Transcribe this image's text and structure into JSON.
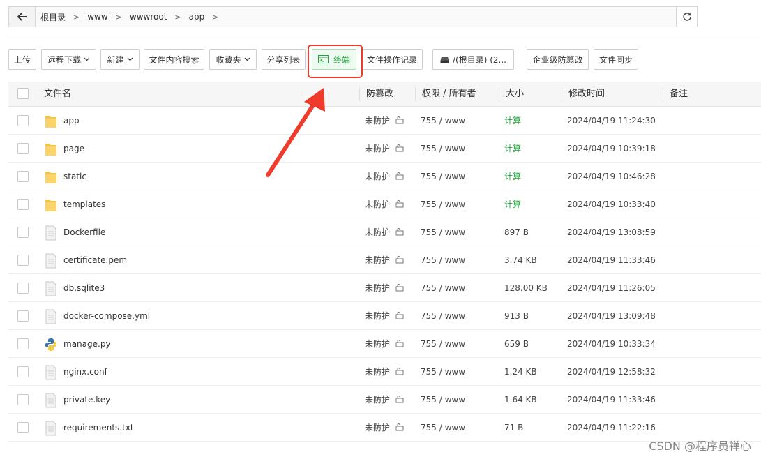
{
  "path": {
    "crumbs": [
      "根目录",
      "www",
      "wwwroot",
      "app"
    ],
    "back_icon": "arrow-left-icon",
    "refresh_icon": "refresh-icon"
  },
  "toolbar": {
    "upload": "上传",
    "remote_download": "远程下载",
    "new": "新建",
    "search_content": "文件内容搜索",
    "favorites": "收藏夹",
    "share_list": "分享列表",
    "terminal": "终端",
    "operation_log": "文件操作记录",
    "disk": "/(根目录) (2...",
    "tamper_proof": "企业级防篡改",
    "file_sync": "文件同步"
  },
  "table": {
    "headers": {
      "name": "文件名",
      "tamper": "防篡改",
      "perm": "权限 / 所有者",
      "size": "大小",
      "mtime": "修改时间",
      "note": "备注"
    },
    "rows": [
      {
        "name": "app",
        "type": "folder",
        "tamper": "未防护",
        "perm": "755 / www",
        "size": "计算",
        "mtime": "2024/04/19 11:24:30"
      },
      {
        "name": "page",
        "type": "folder",
        "tamper": "未防护",
        "perm": "755 / www",
        "size": "计算",
        "mtime": "2024/04/19 10:39:18"
      },
      {
        "name": "static",
        "type": "folder",
        "tamper": "未防护",
        "perm": "755 / www",
        "size": "计算",
        "mtime": "2024/04/19 10:46:28"
      },
      {
        "name": "templates",
        "type": "folder",
        "tamper": "未防护",
        "perm": "755 / www",
        "size": "计算",
        "mtime": "2024/04/19 10:33:40"
      },
      {
        "name": "Dockerfile",
        "type": "file",
        "tamper": "未防护",
        "perm": "755 / www",
        "size": "897 B",
        "mtime": "2024/04/19 13:08:59"
      },
      {
        "name": "certificate.pem",
        "type": "file",
        "tamper": "未防护",
        "perm": "755 / www",
        "size": "3.74 KB",
        "mtime": "2024/04/19 11:33:46"
      },
      {
        "name": "db.sqlite3",
        "type": "file",
        "tamper": "未防护",
        "perm": "755 / www",
        "size": "128.00 KB",
        "mtime": "2024/04/19 11:26:05"
      },
      {
        "name": "docker-compose.yml",
        "type": "file",
        "tamper": "未防护",
        "perm": "755 / www",
        "size": "913 B",
        "mtime": "2024/04/19 13:09:48"
      },
      {
        "name": "manage.py",
        "type": "python",
        "tamper": "未防护",
        "perm": "755 / www",
        "size": "659 B",
        "mtime": "2024/04/19 10:33:34"
      },
      {
        "name": "nginx.conf",
        "type": "file",
        "tamper": "未防护",
        "perm": "755 / www",
        "size": "1.24 KB",
        "mtime": "2024/04/19 12:58:32"
      },
      {
        "name": "private.key",
        "type": "file",
        "tamper": "未防护",
        "perm": "755 / www",
        "size": "1.64 KB",
        "mtime": "2024/04/19 11:33:46"
      },
      {
        "name": "requirements.txt",
        "type": "file",
        "tamper": "未防护",
        "perm": "755 / www",
        "size": "71 B",
        "mtime": "2024/04/19 11:22:16"
      }
    ]
  },
  "watermark": "CSDN @程序员禅心",
  "colors": {
    "accent": "#20a53a",
    "highlight": "#ee3b2b",
    "folder": "#f5c54a"
  }
}
